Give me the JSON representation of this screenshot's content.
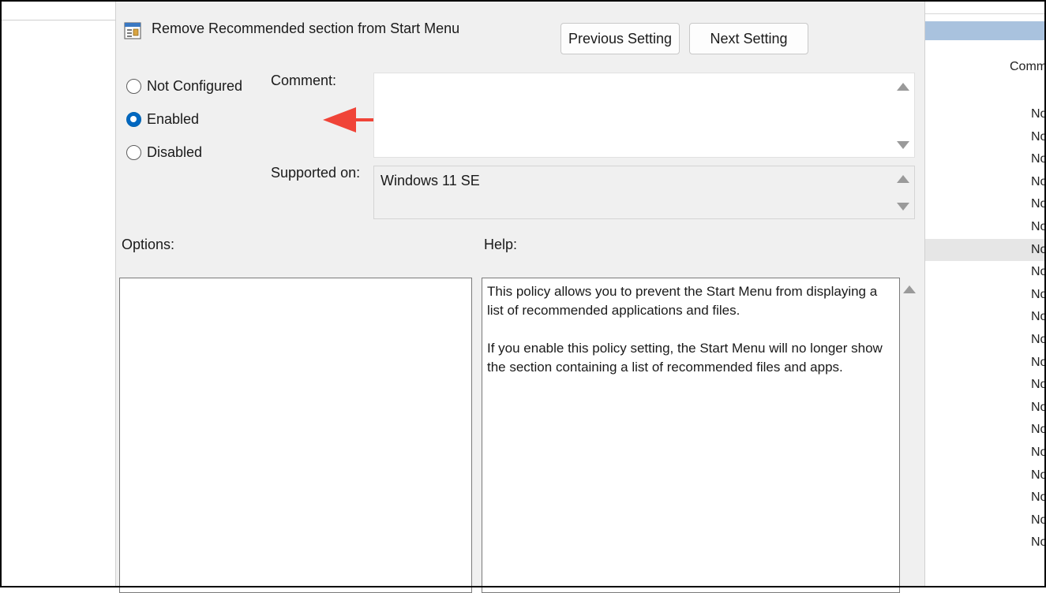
{
  "dialog": {
    "title": "Remove Recommended section from Start Menu",
    "previous_button": "Previous Setting",
    "next_button": "Next Setting",
    "state_options": [
      {
        "label": "Not Configured",
        "checked": false
      },
      {
        "label": "Enabled",
        "checked": true
      },
      {
        "label": "Disabled",
        "checked": false
      }
    ],
    "comment_label": "Comment:",
    "comment_value": "",
    "supported_label": "Supported on:",
    "supported_value": "Windows 11 SE",
    "options_label": "Options:",
    "help_label": "Help:",
    "help_paragraphs": [
      "This policy allows you to prevent the Start Menu from displaying a list of recommended applications and files.",
      "If you enable this policy setting, the Start Menu will no longer show the section containing a list of recommended files and apps."
    ]
  },
  "background_list": {
    "column_header": "Comm",
    "cells": [
      "No",
      "No",
      "No",
      "No",
      "No",
      "No",
      "No",
      "No",
      "No",
      "No",
      "No",
      "No",
      "No",
      "No",
      "No",
      "No",
      "No",
      "No",
      "No",
      "No"
    ]
  },
  "colors": {
    "dialog_bg": "#f0f0f0",
    "radio_selected": "#0067c0",
    "annotation_arrow": "#f04438",
    "list_header": "#a9c2de"
  },
  "icons": {
    "policy": "policy-setting-icon",
    "annotation": "red-pointer-arrow"
  }
}
